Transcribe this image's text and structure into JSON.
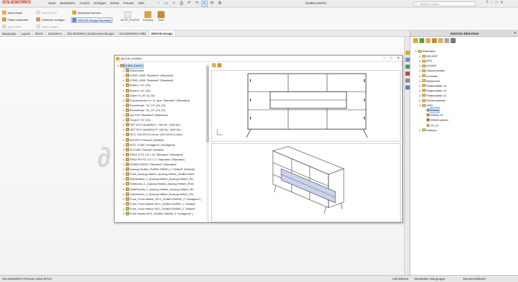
{
  "app": {
    "logo": "SOLIDWORKS",
    "doc_title": "RUBELOWSKI",
    "search_placeholder": "Befehle suchen"
  },
  "menu": [
    "Datei",
    "Bearbeiten",
    "Ansicht",
    "Einfügen",
    "Extras",
    "Fenster",
    "Hilfe"
  ],
  "ribbon": {
    "neue_platte": "Neue Platte",
    "platte_bearbeiten": "Platte bearbeiten",
    "neue_seite": "Neue Seite",
    "neues_profil": "Neues Profil",
    "verbinder_einfuegen": "Verbinder einfügen",
    "neue_kantenform": "Neue Kanten",
    "bearbeite_rahmen": "Bearbeite Rahmen",
    "swood_design_reporting": "SWOOD Design Reporting",
    "auto_platte": "AUTO_PLATTE",
    "gehrung": "Gehrung",
    "stoss": "Stoß"
  },
  "command_tabs": [
    "Baugruppe",
    "Layout",
    "Skizze",
    "Evaluieren",
    "SOLIDWORKS Zusatzanwendungen",
    "SOLIDWORKS MBD",
    "SWOOD Design"
  ],
  "dialog": {
    "title": "Bericht erstellen",
    "tree": [
      {
        "label": "RUBELOWSKI",
        "level": 0,
        "exp": "▾",
        "selected": true
      },
      {
        "label": "Dokumente",
        "level": 1,
        "exp": "▸"
      },
      {
        "label": "47833_4005 \"Standard\" (Standard)",
        "level": 1,
        "exp": "▸"
      },
      {
        "label": "47833_4005 \"Standard\" (Standard)",
        "level": 1,
        "exp": "▸"
      },
      {
        "label": "Bodenr \"19\" (19)",
        "level": 1,
        "exp": "▸"
      },
      {
        "label": "Bodenr \"22\" (22)",
        "level": 1,
        "exp": "▸"
      },
      {
        "label": "Dübel \"8_30\" (8_30)",
        "level": 1,
        "exp": "▸"
      },
      {
        "label": "Euroschraube 5 x 12_dpe \"Standard\" (Standard)",
        "level": 1,
        "exp": "▸"
      },
      {
        "label": "Excentrique \"24_19\" (24_19)",
        "level": 1,
        "exp": "▸"
      },
      {
        "label": "Excentrique \"24_22\" (24_22)",
        "level": 1,
        "exp": "▸"
      },
      {
        "label": "Alu-Fuß \"Standard\" (Standard)",
        "level": 1,
        "exp": "▸"
      },
      {
        "label": "Goujon \"24\" (24)",
        "level": 1,
        "exp": "▸"
      },
      {
        "label": "HETTICH QUADRO L \"400 NL\" (400 NL)",
        "level": 1,
        "exp": "▸"
      },
      {
        "label": "HETTICH QUADRO R \"400 NL\" (400 NL)",
        "level": 1,
        "exp": "▸"
      },
      {
        "label": "9071 \"9071575 D.0mm\" (9071575 D.0mm)",
        "level": 1,
        "exp": "▸"
      },
      {
        "label": "9071575 \"Default\" (Default)",
        "level": 1,
        "exp": "▸"
      },
      {
        "label": "9071 T1452 \"Vorlagend\" (Vorlagend)",
        "level": 1,
        "exp": "▸"
      },
      {
        "label": "9071285 \"Default\" (Default)",
        "level": 1,
        "exp": "▸"
      },
      {
        "label": "SPAX-S PZ 3.5 x 16 \"Standard\" (Standard)",
        "level": 1,
        "exp": "▸"
      },
      {
        "label": "SPAX PH PZ 3.0 x 17 \"Standard\" (Standard)",
        "level": 1,
        "exp": "▸"
      },
      {
        "label": "RUBELOWSKI \"Standard\" (Standard)",
        "level": 1,
        "exp": "▸"
      },
      {
        "label": "Auszug Hettich_RUBELOWSKI_1 \"Default\" (Default)",
        "level": 1,
        "exp": "▸"
      },
      {
        "label": "Front_Auszug Hettich_Auszug Hettich_RUBELOWS",
        "level": 1,
        "exp": "▸"
      },
      {
        "label": "Rueckwand_1_Auszug Hettich_Auszug Hettich_RU",
        "level": 1,
        "exp": "▸"
      },
      {
        "label": "SeiteLinks_1_Auszug Hettich_Auszug Hettich_RUB",
        "level": 1,
        "exp": "▸"
      },
      {
        "label": "SeiteRechts_1_Auszug Hettich_Auszug Hettich_RU",
        "level": 1,
        "exp": "▸"
      },
      {
        "label": "Unterboden_1_Auszug Hettich_Auszug Hettich_RU",
        "level": 1,
        "exp": "▸"
      },
      {
        "label": "Front_Front Hettich_9071_RUBELOW590_1 \"Vorlagend\" (",
        "level": 1,
        "exp": "▸"
      },
      {
        "label": "Front_Front Hettich 9071_RUBELOW590_1 \"Default\"",
        "level": 1,
        "exp": "▸"
      },
      {
        "label": "Front_Front Hettich 9071_RUBELOW590_2 \"Default\"",
        "level": 1,
        "exp": "▸"
      },
      {
        "label": "Front Hettich 9071_RUBELOW590_3 \"Vorlagend\" (",
        "level": 1,
        "exp": "▸"
      }
    ]
  },
  "library": {
    "title": "SWOOD Bibliothek",
    "tree": [
      {
        "label": "Materialien",
        "level": 0,
        "exp": "▾",
        "kind": "folder"
      },
      {
        "label": "ANLAGE",
        "level": 1,
        "exp": "▸",
        "kind": "folder"
      },
      {
        "label": "DPS",
        "level": 1,
        "exp": "▸",
        "kind": "folder"
      },
      {
        "label": "EGGER",
        "level": 1,
        "exp": "▸",
        "kind": "folder"
      },
      {
        "label": "Glaswerkstoffe",
        "level": 1,
        "exp": "▸",
        "kind": "folder"
      },
      {
        "label": "Laminate",
        "level": 1,
        "exp": "▸",
        "kind": "folder"
      },
      {
        "label": "Massivholz",
        "level": 1,
        "exp": "▸",
        "kind": "folder"
      },
      {
        "label": "Plattenstärke 16",
        "level": 1,
        "exp": "▸",
        "kind": "folder"
      },
      {
        "label": "Plattenstärke 19",
        "level": 1,
        "exp": "▸",
        "kind": "folder"
      },
      {
        "label": "Plattenstärke 22",
        "level": 1,
        "exp": "▸",
        "kind": "folder"
      },
      {
        "label": "Sondermaterial",
        "level": 1,
        "exp": "▸",
        "kind": "folder"
      },
      {
        "label": "V622",
        "level": 1,
        "exp": "▾",
        "kind": "folder"
      },
      {
        "label": "Wirtold",
        "level": 2,
        "exp": "",
        "kind": "material",
        "color": "#8a9bb0",
        "selected": true
      },
      {
        "label": "Wirtold 30",
        "level": 2,
        "exp": "",
        "kind": "material",
        "color": "#b58a55"
      },
      {
        "label": "Wirtold grosso",
        "level": 2,
        "exp": "",
        "kind": "material",
        "color": "#9f7b4a"
      },
      {
        "label": "V6_22",
        "level": 2,
        "exp": "",
        "kind": "material",
        "color": "#c9a56e"
      },
      {
        "label": "Webinar",
        "level": 1,
        "exp": "▸",
        "kind": "folder"
      }
    ]
  },
  "status": {
    "left": "SOLIDWORKS Premium 2018 SP3.0",
    "mid1": "Voll definiert",
    "mid2": "Bearbeiten: Baugruppe",
    "right": "Benutzerdefiniert"
  },
  "colors": {
    "brand": "#d52b1e",
    "selection": "#cce4f7",
    "front_panel": "#c9d4ec"
  }
}
